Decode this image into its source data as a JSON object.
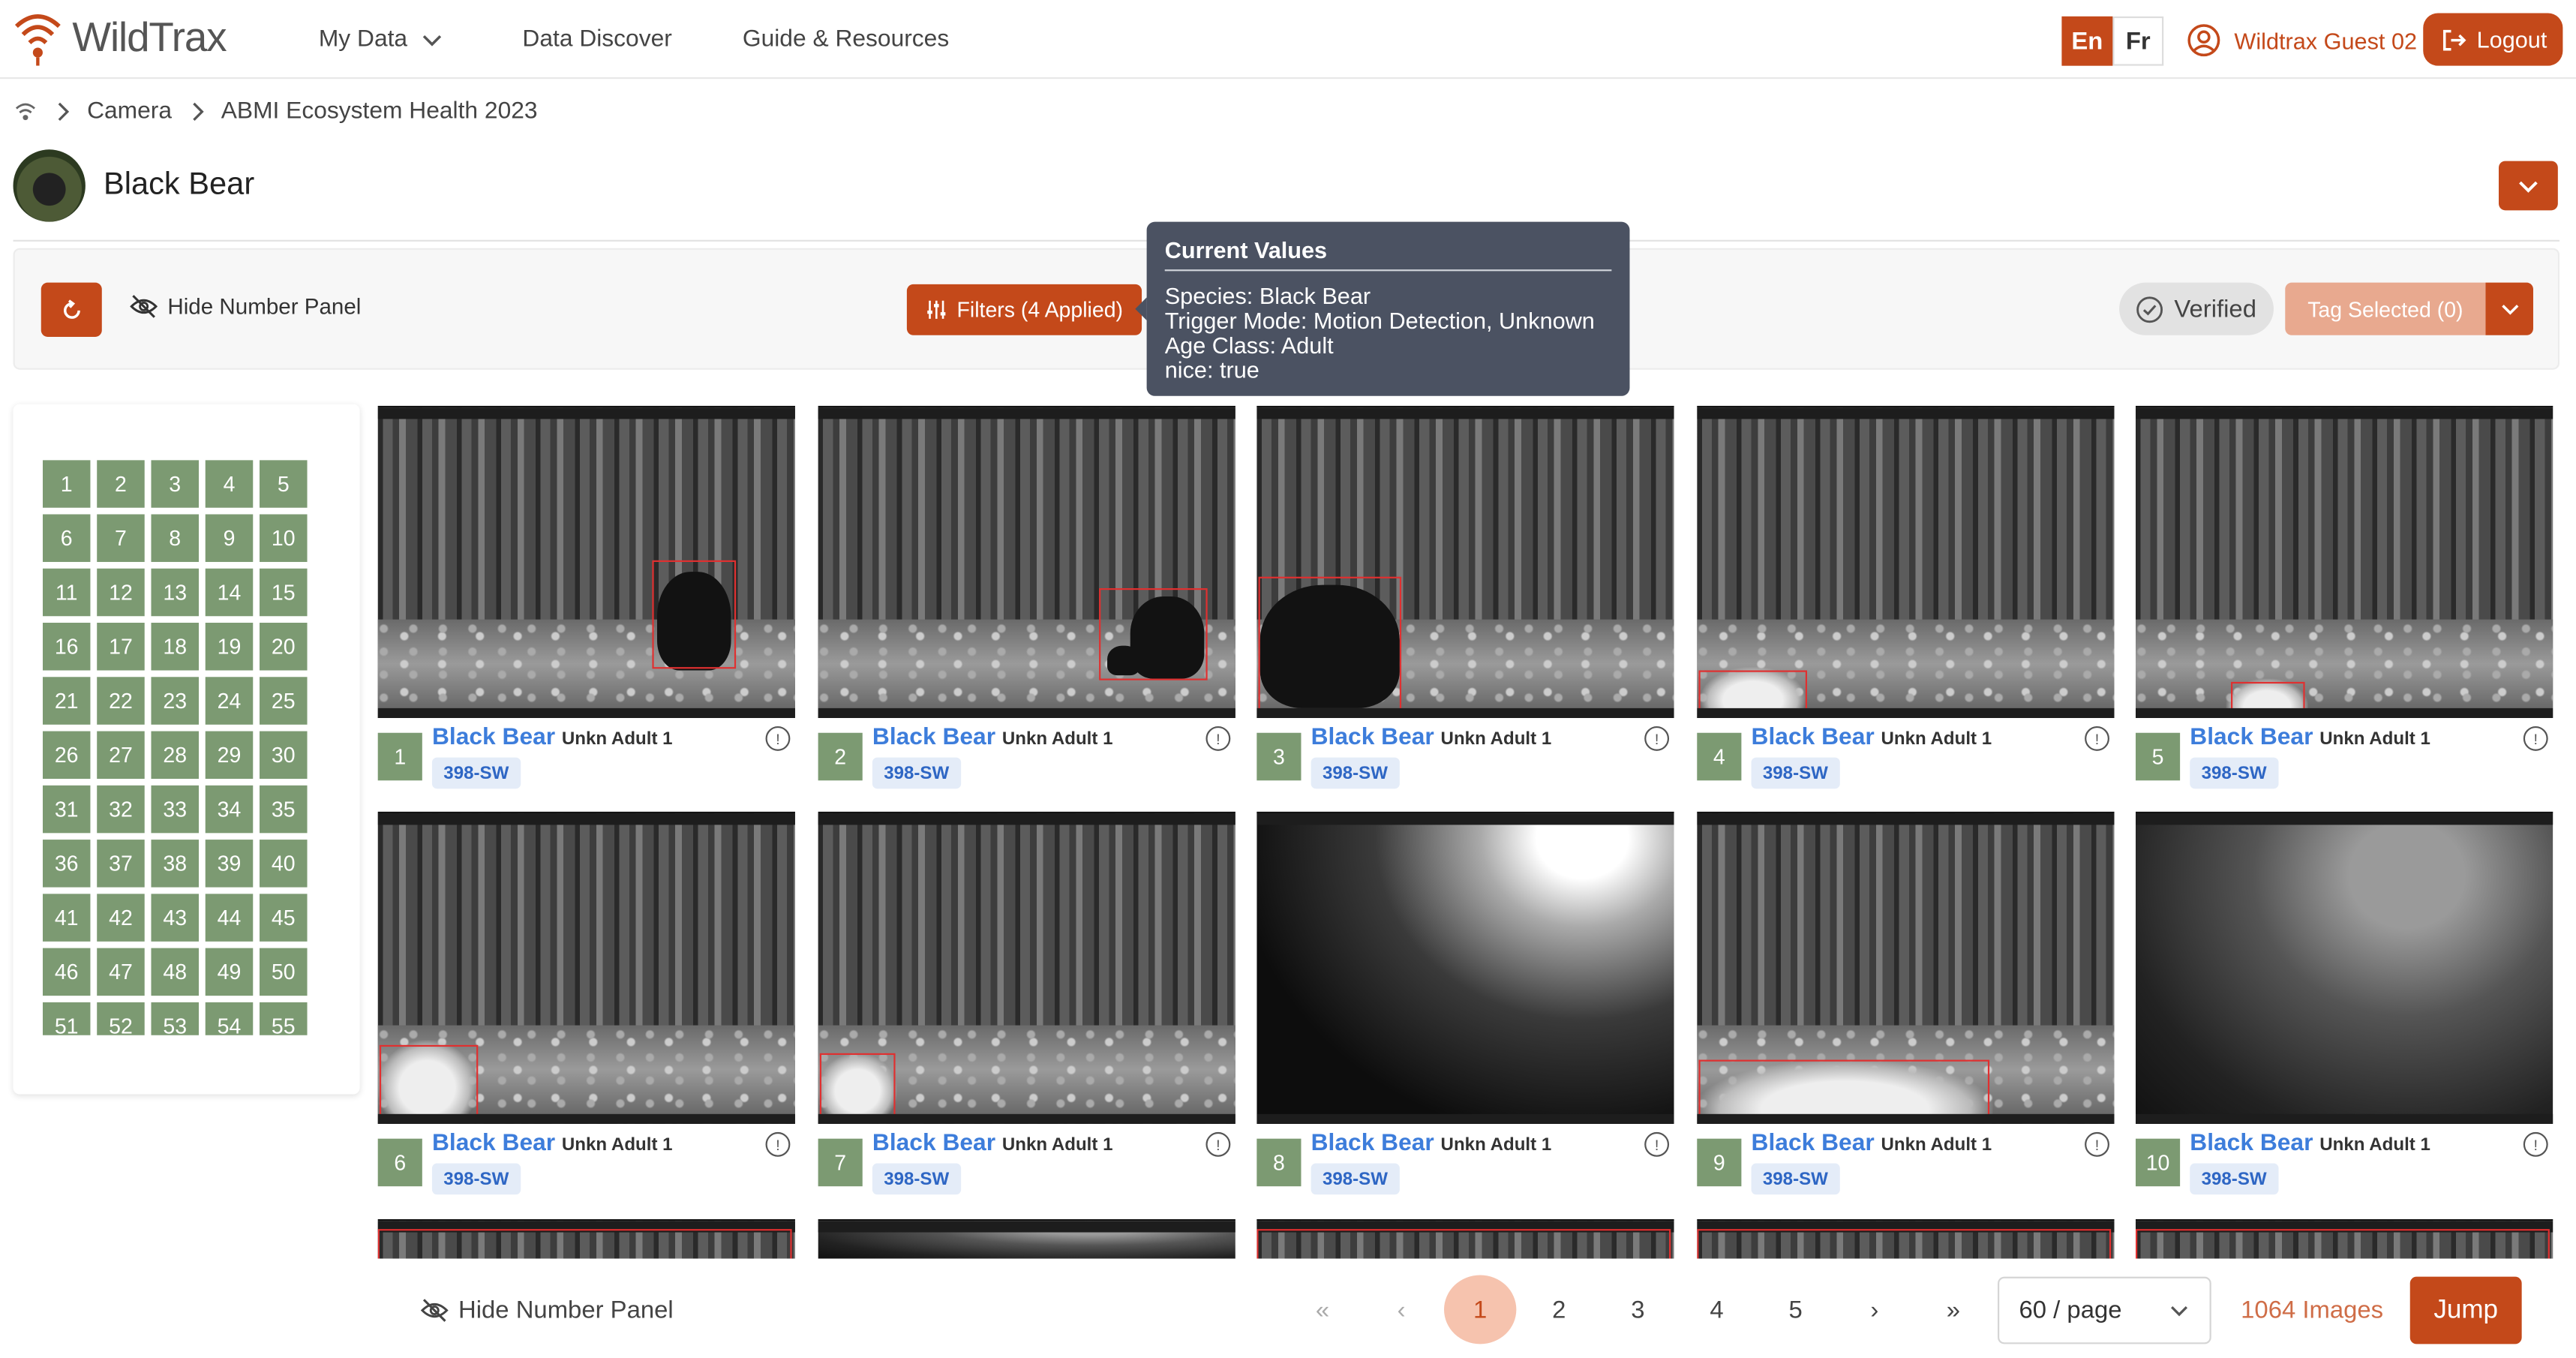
{
  "header": {
    "logo_text": "WildTrax",
    "nav": {
      "my_data": "My Data",
      "data_discover": "Data Discover",
      "guide": "Guide & Resources"
    },
    "lang_en": "En",
    "lang_fr": "Fr",
    "user_name": "Wildtrax Guest 02",
    "logout": "Logout",
    "accent": "#c4491a"
  },
  "breadcrumb": {
    "items": [
      "Camera",
      "ABMI Ecosystem Health 2023"
    ]
  },
  "page": {
    "title": "Black Bear"
  },
  "toolbar": {
    "hide_number_panel": "Hide Number Panel",
    "filters": "Filters (4 Applied)",
    "verified": "Verified",
    "tag_selected": "Tag Selected (0)"
  },
  "tooltip": {
    "heading": "Current Values",
    "lines": [
      "Species: Black Bear",
      "Trigger Mode: Motion Detection, Unknown",
      "Age Class: Adult",
      "nice: true"
    ]
  },
  "number_panel": {
    "numbers": [
      "1",
      "2",
      "3",
      "4",
      "5",
      "6",
      "7",
      "8",
      "9",
      "10",
      "11",
      "12",
      "13",
      "14",
      "15",
      "16",
      "17",
      "18",
      "19",
      "20",
      "21",
      "22",
      "23",
      "24",
      "25",
      "26",
      "27",
      "28",
      "29",
      "30",
      "31",
      "32",
      "33",
      "34",
      "35",
      "36",
      "37",
      "38",
      "39",
      "40",
      "41",
      "42",
      "43",
      "44",
      "45",
      "46",
      "47",
      "48",
      "49",
      "50",
      "51",
      "52",
      "53",
      "54",
      "55"
    ]
  },
  "images": [
    {
      "num": "1",
      "species": "Black Bear",
      "meta": "Unkn Adult 1",
      "tag": "398-SW",
      "info": "!",
      "scene": "forest"
    },
    {
      "num": "2",
      "species": "Black Bear",
      "meta": "Unkn Adult 1",
      "tag": "398-SW",
      "info": "!",
      "scene": "forest"
    },
    {
      "num": "3",
      "species": "Black Bear",
      "meta": "Unkn Adult 1",
      "tag": "398-SW",
      "info": "!",
      "scene": "forest"
    },
    {
      "num": "4",
      "species": "Black Bear",
      "meta": "Unkn Adult 1",
      "tag": "398-SW",
      "info": "!",
      "scene": "forest"
    },
    {
      "num": "5",
      "species": "Black Bear",
      "meta": "Unkn Adult 1",
      "tag": "398-SW",
      "info": "!",
      "scene": "forest"
    },
    {
      "num": "6",
      "species": "Black Bear",
      "meta": "Unkn Adult 1",
      "tag": "398-SW",
      "info": "!",
      "scene": "forest"
    },
    {
      "num": "7",
      "species": "Black Bear",
      "meta": "Unkn Adult 1",
      "tag": "398-SW",
      "info": "!",
      "scene": "forest"
    },
    {
      "num": "8",
      "species": "Black Bear",
      "meta": "Unkn Adult 1",
      "tag": "398-SW",
      "info": "!",
      "scene": "flare"
    },
    {
      "num": "9",
      "species": "Black Bear",
      "meta": "Unkn Adult 1",
      "tag": "398-SW",
      "info": "!",
      "scene": "forest"
    },
    {
      "num": "10",
      "species": "Black Bear",
      "meta": "Unkn Adult 1",
      "tag": "398-SW",
      "info": "!",
      "scene": "flare2"
    }
  ],
  "footer": {
    "hide_number_panel": "Hide Number Panel",
    "pagination": {
      "first": "«",
      "prev": "‹",
      "next": "›",
      "last": "»",
      "pages": [
        "1",
        "2",
        "3",
        "4",
        "5"
      ],
      "current": "1"
    },
    "per_page": "60 / page",
    "image_count": "1064 Images",
    "jump": "Jump"
  }
}
